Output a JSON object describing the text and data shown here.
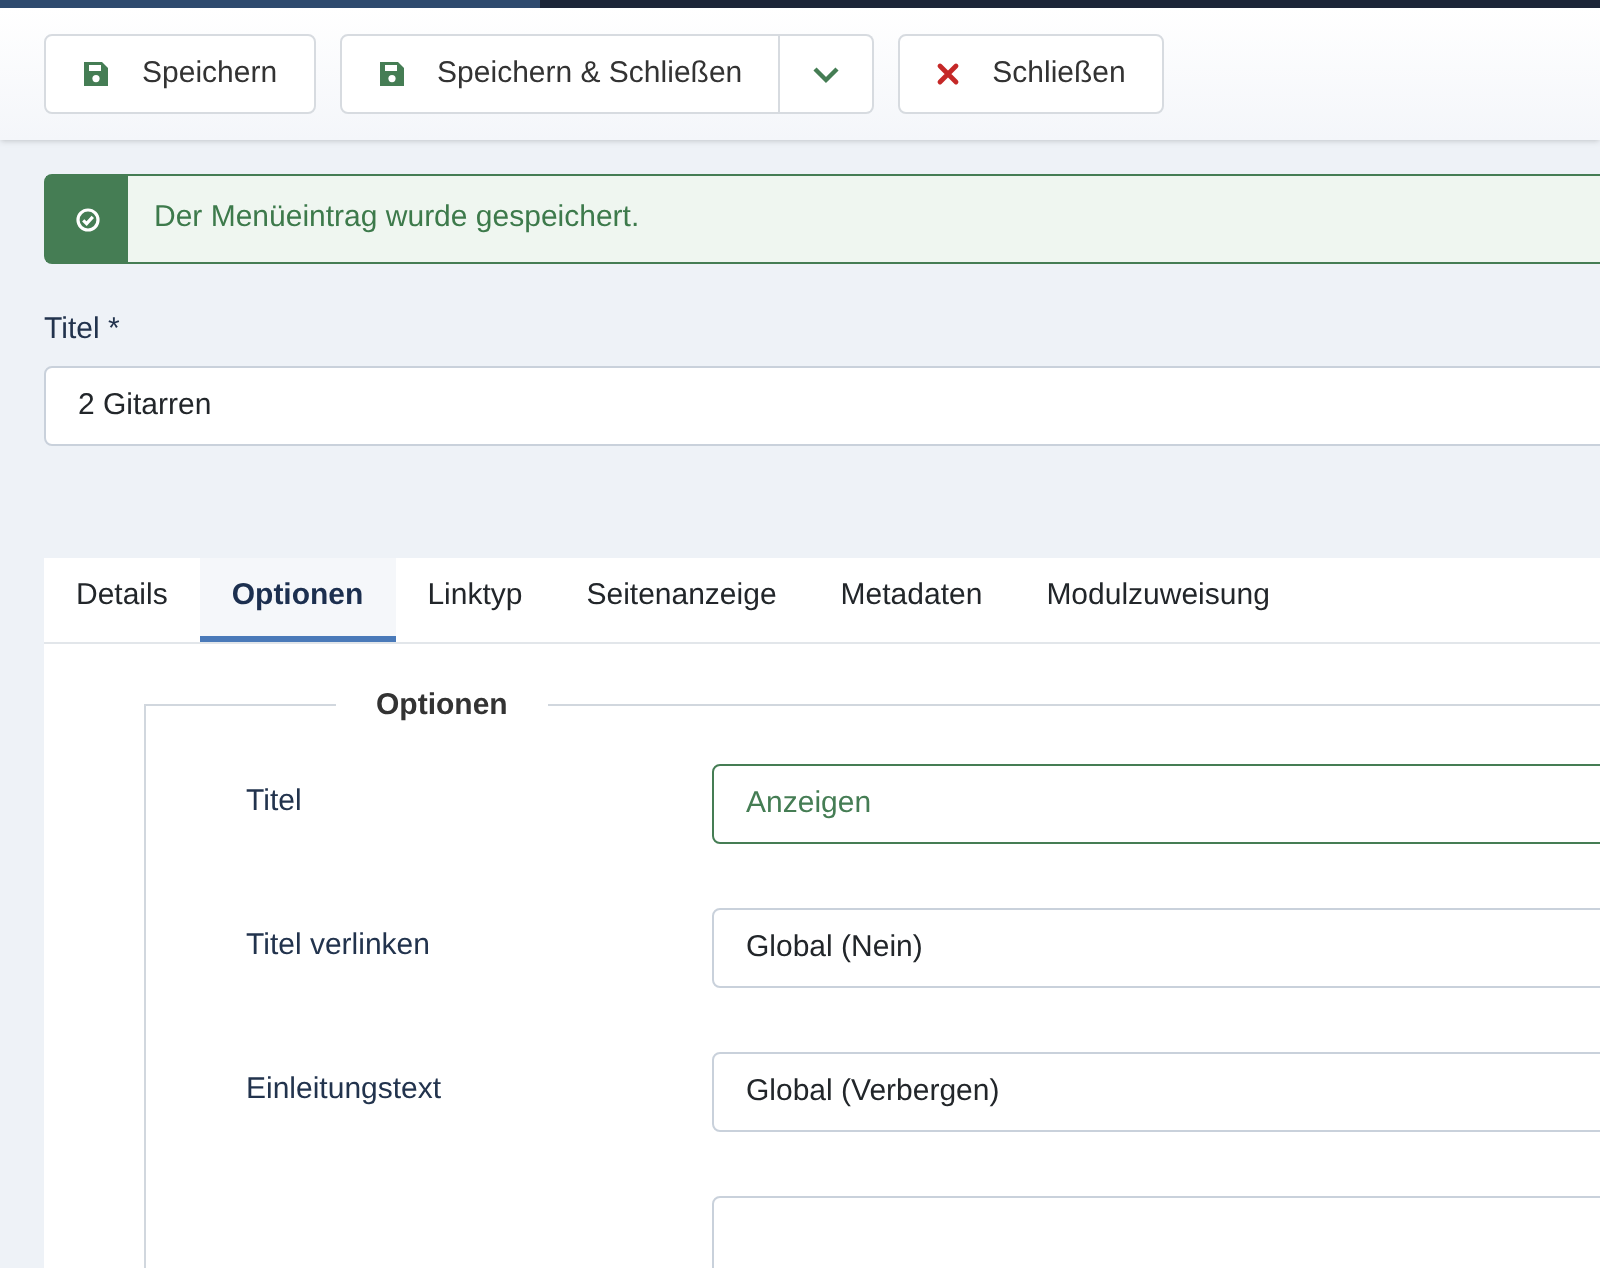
{
  "toolbar": {
    "buttons": [
      {
        "label": "Speichern",
        "kind": "save",
        "dropdown": false
      },
      {
        "label": "Speichern & Schließen",
        "kind": "save",
        "dropdown": true
      },
      {
        "label": "Schließen",
        "kind": "close",
        "dropdown": false
      }
    ]
  },
  "alert": {
    "message": "Der Menüeintrag wurde gespeichert."
  },
  "title_field": {
    "label": "Titel *",
    "value": "2 Gitarren"
  },
  "tabs": [
    {
      "label": "Details",
      "selected": false
    },
    {
      "label": "Optionen",
      "selected": true
    },
    {
      "label": "Linktyp",
      "selected": false
    },
    {
      "label": "Seitenanzeige",
      "selected": false
    },
    {
      "label": "Metadaten",
      "selected": false
    },
    {
      "label": "Modulzuweisung",
      "selected": false
    }
  ],
  "fieldset": {
    "legend": "Optionen",
    "rows": [
      {
        "label": "Titel",
        "value": "Anzeigen",
        "modified": true
      },
      {
        "label": "Titel verlinken",
        "value": "Global (Nein)",
        "modified": false
      },
      {
        "label": "Einleitungstext",
        "value": "Global (Verbergen)",
        "modified": false
      }
    ]
  }
}
